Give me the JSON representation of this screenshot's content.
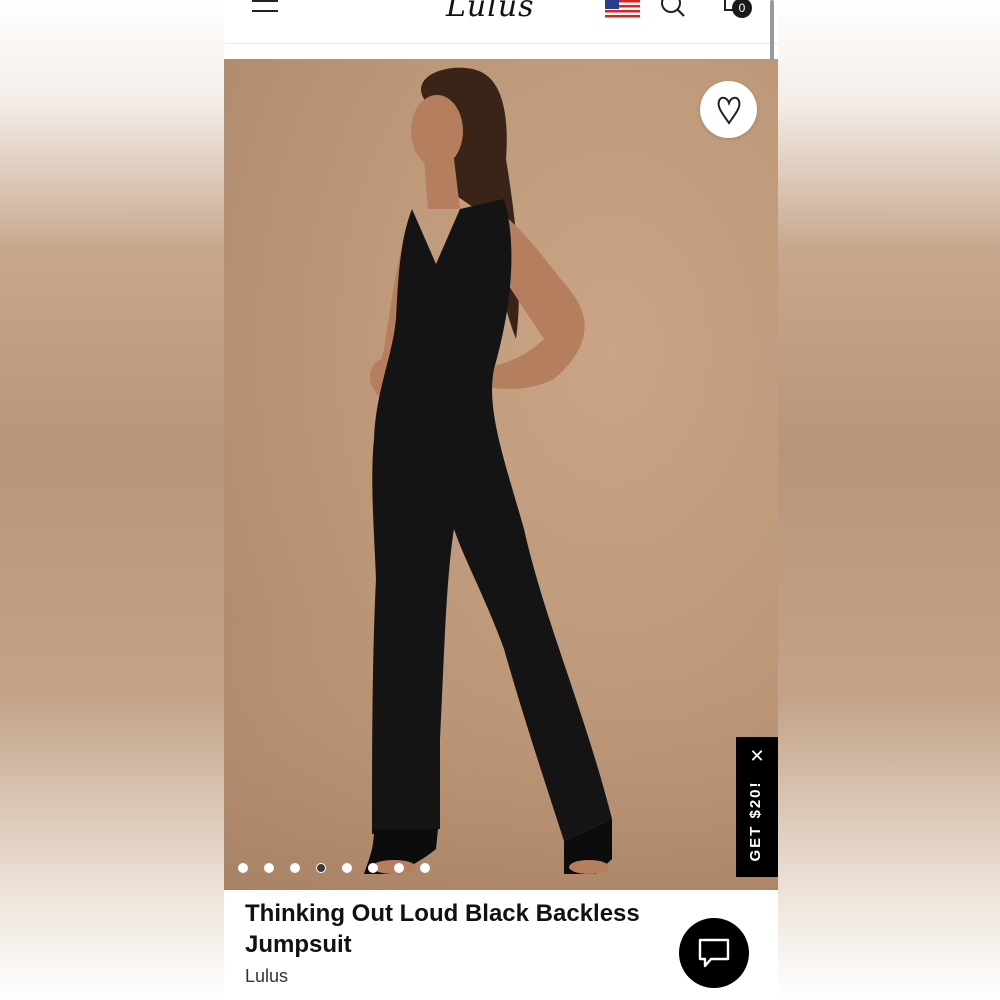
{
  "header": {
    "logo_text": "Lulus",
    "icons": [
      "menu-icon",
      "us-flag-icon",
      "search-icon",
      "cart-icon"
    ],
    "cart_count": "0"
  },
  "gallery": {
    "image_count": 8,
    "active_index": 3,
    "wishlist_icon": "heart-icon"
  },
  "promo": {
    "label": "GET $20!",
    "close_icon": "close-icon"
  },
  "product": {
    "title": "Thinking Out Loud Black Backless Jumpsuit",
    "brand": "Lulus"
  },
  "chat": {
    "icon": "chat-icon"
  },
  "colors": {
    "background_tan": "#bf9a7b",
    "jumpsuit_black": "#141414",
    "header_bg": "#ffffff",
    "promo_bg": "#000000"
  }
}
